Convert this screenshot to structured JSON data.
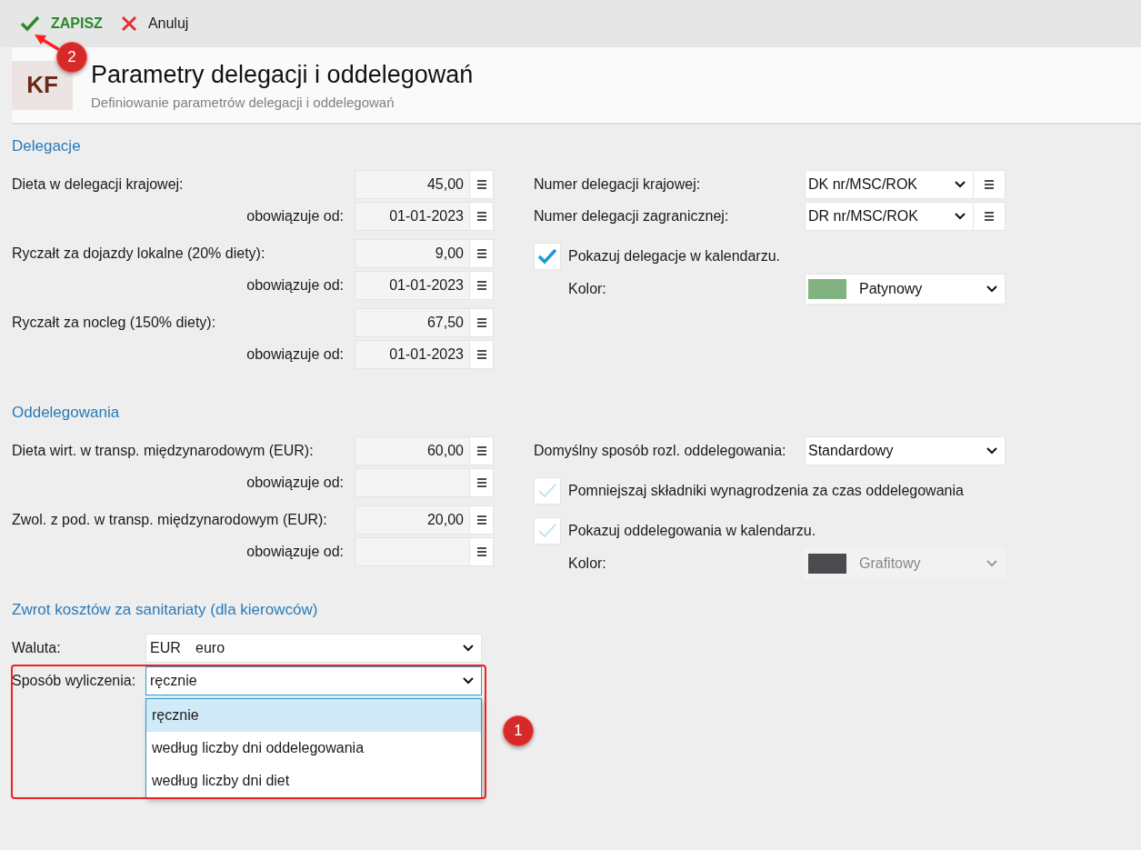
{
  "toolbar": {
    "callout": "2",
    "buttons": [
      {
        "kind": "save",
        "label": "ZAPISZ"
      },
      {
        "kind": "cancel",
        "label": "Anuluj"
      }
    ]
  },
  "header": {
    "logo": "KF",
    "title": "Parametry delegacji i oddelegowań",
    "subtitle": "Definiowanie parametrów delegacji i oddelegowań"
  },
  "sections": [
    {
      "title": "Delegacje",
      "left": [
        {
          "kind": "main",
          "label": "Dieta w delegacji krajowej:",
          "value": "45,00"
        },
        {
          "kind": "sub",
          "label": "obowiązuje od:",
          "value": "01-01-2023"
        },
        {
          "kind": "main",
          "label": "Ryczałt za dojazdy lokalne (20% diety):",
          "value": "9,00"
        },
        {
          "kind": "sub",
          "label": "obowiązuje od:",
          "value": "01-01-2023"
        },
        {
          "kind": "main",
          "label": "Ryczałt za nocleg (150% diety):",
          "value": "67,50"
        },
        {
          "kind": "sub",
          "label": "obowiązuje od:",
          "value": "01-01-2023"
        }
      ],
      "right": [
        {
          "kind": "menu_select",
          "label": "Numer delegacji krajowej:",
          "value": "DK nr/MSC/ROK"
        },
        {
          "kind": "menu_select",
          "label": "Numer delegacji zagranicznej:",
          "value": "DR nr/MSC/ROK"
        },
        {
          "kind": "checkbox",
          "label": "Pokazuj delegacje w kalendarzu.",
          "checked": true
        },
        {
          "kind": "color",
          "label": "Kolor:",
          "value": "Patynowy",
          "color": "#80b380",
          "disabled": false
        }
      ]
    },
    {
      "title": "Oddelegowania",
      "left": [
        {
          "kind": "main",
          "label": "Dieta wirt. w transp. międzynarodowym (EUR):",
          "value": "60,00"
        },
        {
          "kind": "sub",
          "label": "obowiązuje od:"
        },
        {
          "kind": "main",
          "label": "Zwol. z pod. w transp. międzynarodowym (EUR):",
          "value": "20,00"
        },
        {
          "kind": "sub",
          "label": "obowiązuje od:"
        }
      ],
      "right": [
        {
          "kind": "select",
          "label": "Domyślny sposób rozl. oddelegowania:",
          "value": "Standardowy"
        },
        {
          "kind": "checkbox",
          "label": "Pomniejszaj składniki wynagrodzenia za czas oddelegowania",
          "checked": false
        },
        {
          "kind": "checkbox",
          "label": "Pokazuj oddelegowania w kalendarzu.",
          "checked": false
        },
        {
          "kind": "color",
          "label": "Kolor:",
          "value": "Grafitowy",
          "color": "#4a4a4f",
          "disabled": true
        }
      ]
    }
  ],
  "sanitary": {
    "title": "Zwrot kosztów za sanitariaty (dla kierowców)",
    "fields": [
      {
        "label": "Waluta:",
        "code": "EUR",
        "value": "euro",
        "focused": false
      },
      {
        "label": "Sposób wyliczenia:",
        "value": "ręcznie",
        "focused": true,
        "callout": "1",
        "options": [
          {
            "label": "ręcznie",
            "selected": true
          },
          {
            "label": "według liczby dni oddelegowania",
            "selected": false
          },
          {
            "label": "według liczby dni diet",
            "selected": false
          }
        ]
      }
    ]
  }
}
